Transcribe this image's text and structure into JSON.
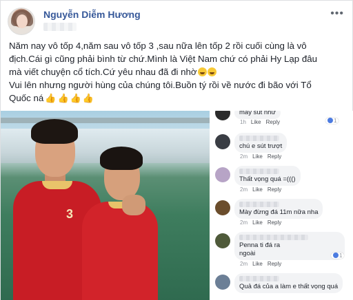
{
  "post": {
    "author": "Nguyễn Diễm Hương",
    "more_label": "•••",
    "line1": "Năm nay vô tốp 4,năm sau vô tốp 3 ,sau nữa lên tốp 2 rồi cuối cùng là vô",
    "line2": "địch.Cái gì cũng phải bình từ chứ.Mình là Việt Nam chứ có phải Hy Lạp đâu",
    "line3": "mà viết chuyện cổ tích.Cứ yêu nhau đã đi nhờ",
    "line4": "Vui lên nhưng người hùng của chúng tôi.Buồn tý rồi về nước đi bão với Tổ",
    "line5": "Quốc ná",
    "emoji_icons": [
      "rofl-emoji-icon",
      "rofl-emoji-icon"
    ],
    "thumbs_up_count": 4
  },
  "photo": {
    "description_icon": "football-players-photo",
    "jersey_number": "3"
  },
  "comments": [
    {
      "text": "máy sút như",
      "meta": "1h",
      "like": "Like",
      "reply": "Reply",
      "reaction_count": "1"
    },
    {
      "text": "chú e sút trượt",
      "meta": "2m",
      "like": "Like",
      "reply": "Reply",
      "reaction_count": ""
    },
    {
      "text": "Thất vọng quá =((()",
      "meta": "2m",
      "like": "Like",
      "reply": "Reply",
      "reaction_count": ""
    },
    {
      "text": "Mày đừng đá 11m nữa nha",
      "meta": "2m",
      "like": "Like",
      "reply": "Reply",
      "reaction_count": ""
    },
    {
      "text": "Penna ti đá ra",
      "text2": "ngoài",
      "meta": "2m",
      "like": "Like",
      "reply": "Reply",
      "reaction_count": "1"
    },
    {
      "text": "Quả đá của a làm e thất vọng quá",
      "meta": "2m",
      "like": "Like",
      "reply": "Reply",
      "reaction_count": ""
    }
  ],
  "colors": {
    "author_link": "#365899",
    "jersey_red": "#c81d25",
    "like_blue": "#4c7be0"
  }
}
